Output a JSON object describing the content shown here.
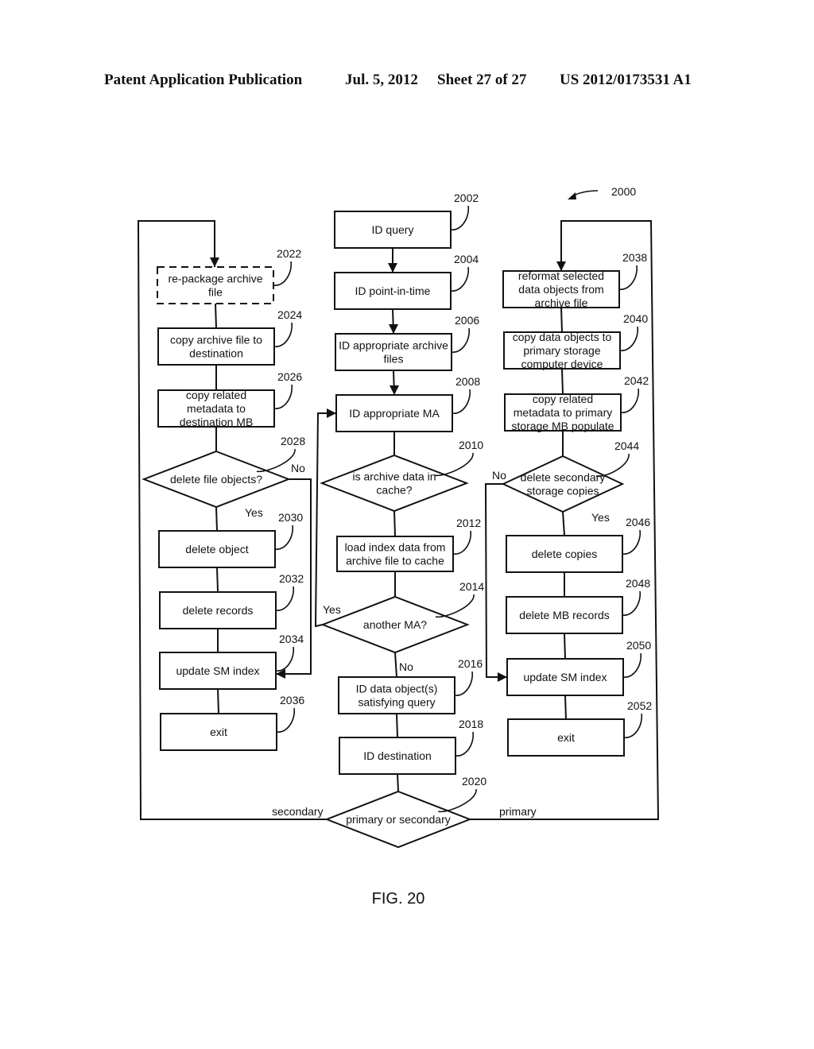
{
  "header": {
    "publication": "Patent Application Publication",
    "date": "Jul. 5, 2012",
    "sheet": "Sheet 27 of 27",
    "number": "US 2012/0173531 A1"
  },
  "figure": {
    "caption": "FIG. 20",
    "ref": "2000"
  },
  "center": {
    "n2002": {
      "ref": "2002",
      "lines": [
        "ID query"
      ]
    },
    "n2004": {
      "ref": "2004",
      "lines": [
        "ID point-in-time"
      ]
    },
    "n2006": {
      "ref": "2006",
      "lines": [
        "ID appropriate archive",
        "files"
      ]
    },
    "n2008": {
      "ref": "2008",
      "lines": [
        "ID appropriate MA"
      ]
    },
    "n2010": {
      "ref": "2010",
      "lines": [
        "is archive data in",
        "cache?"
      ]
    },
    "n2012": {
      "ref": "2012",
      "lines": [
        "load index data from",
        "archive file to cache"
      ]
    },
    "n2014": {
      "ref": "2014",
      "lines": [
        "another MA?"
      ],
      "yes": "Yes",
      "no": "No"
    },
    "n2016": {
      "ref": "2016",
      "lines": [
        "ID data object(s)",
        "satisfying query"
      ]
    },
    "n2018": {
      "ref": "2018",
      "lines": [
        "ID destination"
      ]
    },
    "n2020": {
      "ref": "2020",
      "lines": [
        "primary or secondary"
      ],
      "left": "secondary",
      "right": "primary"
    }
  },
  "left": {
    "n2022": {
      "ref": "2022",
      "lines": [
        "re-package archive",
        "file"
      ]
    },
    "n2024": {
      "ref": "2024",
      "lines": [
        "copy archive file to",
        "destination"
      ]
    },
    "n2026": {
      "ref": "2026",
      "lines": [
        "copy related",
        "metadata to",
        "destination MB"
      ]
    },
    "n2028": {
      "ref": "2028",
      "lines": [
        "delete file objects?"
      ],
      "yes": "Yes",
      "no": "No"
    },
    "n2030": {
      "ref": "2030",
      "lines": [
        "delete object"
      ]
    },
    "n2032": {
      "ref": "2032",
      "lines": [
        "delete records"
      ]
    },
    "n2034": {
      "ref": "2034",
      "lines": [
        "update SM index"
      ]
    },
    "n2036": {
      "ref": "2036",
      "lines": [
        "exit"
      ]
    }
  },
  "right": {
    "n2038": {
      "ref": "2038",
      "lines": [
        "reformat selected",
        "data objects from",
        "archive file"
      ]
    },
    "n2040": {
      "ref": "2040",
      "lines": [
        "copy data objects to",
        "primary storage",
        "computer device"
      ]
    },
    "n2042": {
      "ref": "2042",
      "lines": [
        "copy related",
        "metadata to primary",
        "storage MB populate"
      ]
    },
    "n2044": {
      "ref": "2044",
      "lines": [
        "delete secondary",
        "storage copies"
      ],
      "yes": "Yes",
      "no": "No"
    },
    "n2046": {
      "ref": "2046",
      "lines": [
        "delete copies"
      ]
    },
    "n2048": {
      "ref": "2048",
      "lines": [
        "delete MB records"
      ]
    },
    "n2050": {
      "ref": "2050",
      "lines": [
        "update SM index"
      ]
    },
    "n2052": {
      "ref": "2052",
      "lines": [
        "exit"
      ]
    }
  }
}
